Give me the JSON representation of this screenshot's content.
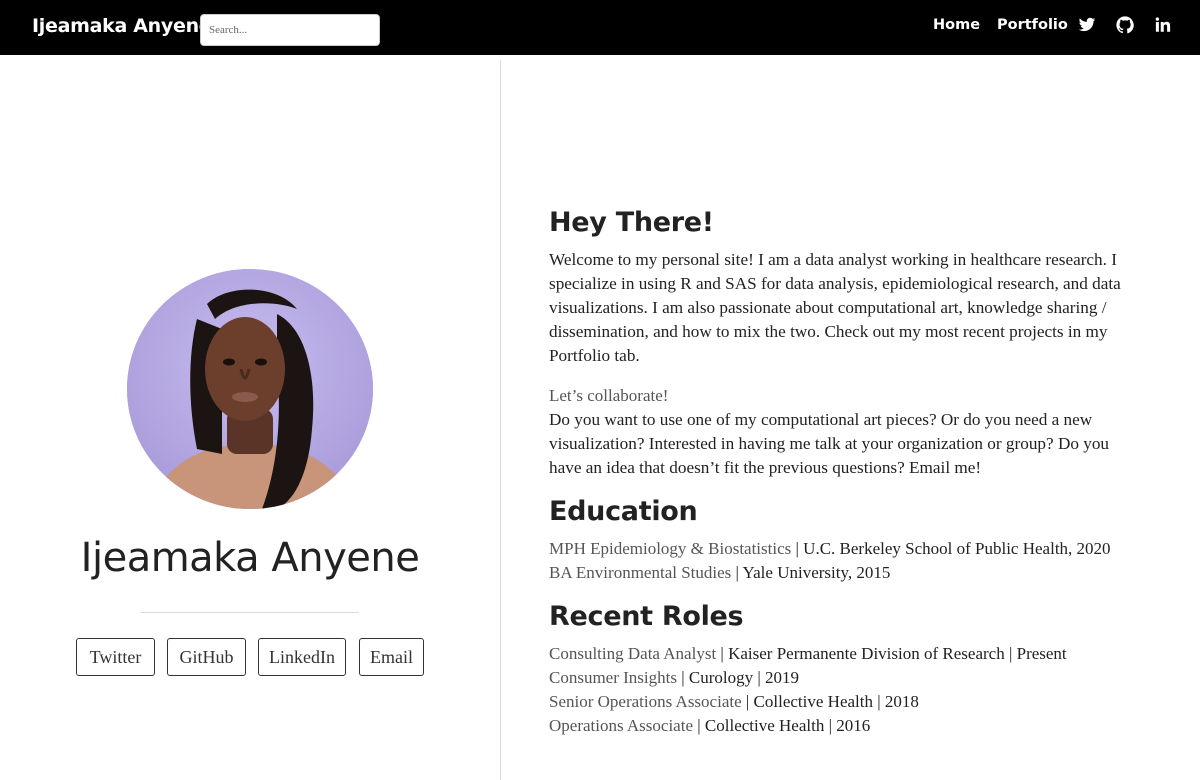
{
  "nav": {
    "brand": "Ijeamaka Anyene",
    "search_placeholder": "Search...",
    "links": [
      "Home",
      "Portfolio"
    ],
    "icons": [
      "twitter-icon",
      "github-icon",
      "linkedin-icon"
    ]
  },
  "profile": {
    "name": "Ijeamaka Anyene",
    "buttons": [
      "Twitter",
      "GitHub",
      "LinkedIn",
      "Email"
    ]
  },
  "intro": {
    "heading": "Hey There!",
    "body": "Welcome to my personal site! I am a data analyst working in healthcare research. I specialize in using R and SAS for data analysis, epidemiological research, and data visualizations. I am also passionate about computational art, knowledge sharing / dissemination, and how to mix the two. Check out my most recent projects in my Portfolio tab.",
    "collab_title": "Let’s collaborate!",
    "collab_body": "Do you want to use one of my computational art pieces? Or do you need a new visualization? Interested in having me talk at your organization or group? Do you have an idea that doesn’t fit the previous questions? Email me!"
  },
  "education": {
    "heading": "Education",
    "items": [
      {
        "degree": "MPH Epidemiology & Biostatistics",
        "detail": " | U.C. Berkeley School of Public Health, 2020"
      },
      {
        "degree": "BA Environmental Studies",
        "detail": " | Yale University, 2015"
      }
    ]
  },
  "roles": {
    "heading": "Recent Roles",
    "items": [
      {
        "title": "Consulting Data Analyst",
        "detail": " | Kaiser Permanente Division of Research | Present"
      },
      {
        "title": "Consumer Insights",
        "detail": " | Curology | 2019"
      },
      {
        "title": "Senior Operations Associate",
        "detail": " | Collective Health | 2018"
      },
      {
        "title": "Operations Associate",
        "detail": " | Collective Health | 2016"
      }
    ]
  }
}
